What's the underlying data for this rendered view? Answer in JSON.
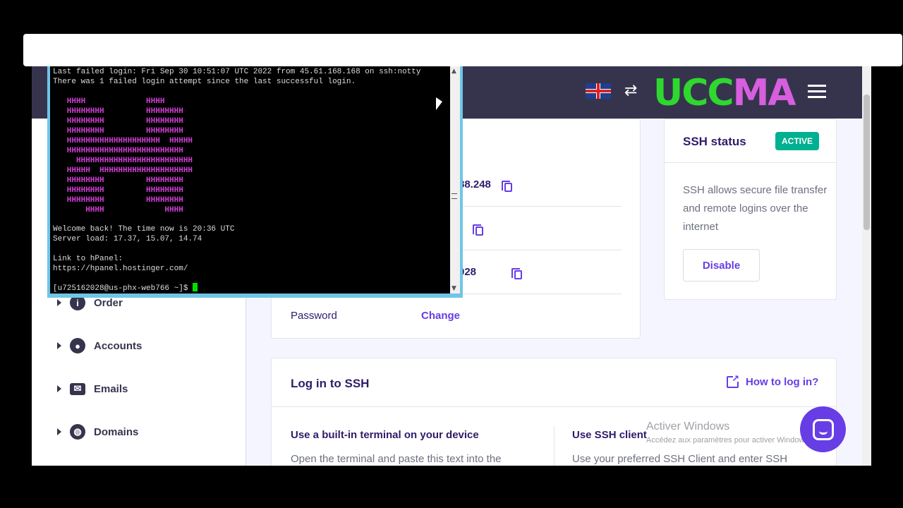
{
  "topbar": {
    "flag_icon": "uk-flag-icon",
    "switch_icon": "arrows-icon",
    "menu_icon": "hamburger-icon"
  },
  "logo": {
    "text_green": "UCC",
    "text_pink": "MA"
  },
  "sidebar": {
    "items": [
      {
        "label": "Order",
        "icon": "info-icon"
      },
      {
        "label": "Accounts",
        "icon": "user-icon"
      },
      {
        "label": "Emails",
        "icon": "mail-icon"
      },
      {
        "label": "Domains",
        "icon": "globe-icon"
      }
    ]
  },
  "ssh_details": {
    "ip_partial": "88.248",
    "port_partial": "",
    "user_partial": "028",
    "password_label": "Password",
    "password_action": "Change"
  },
  "ssh_status": {
    "title": "SSH status",
    "badge": "ACTIVE",
    "description": "SSH allows secure file transfer and remote logins over the internet",
    "button": "Disable"
  },
  "login_ssh": {
    "title": "Log in to SSH",
    "help_link": "How to log in?",
    "col1_title": "Use a built-in terminal on your device",
    "col1_text": "Open the terminal and paste this text into the",
    "col2_title": "Use SSH client",
    "col2_text": "Use your preferred SSH Client and enter SSH"
  },
  "terminal": {
    "line1": "Last failed login: Fri Sep 30 10:51:07 UTC 2022 from 45.61.168.168 on ssh:notty",
    "line2": "There was 1 failed login attempt since the last successful login.",
    "art": [
      "   HHHH             HHHH",
      "   HHHHHHHH         HHHHHHHH",
      "   HHHHHHHH         HHHHHHHH",
      "   HHHHHHHH         HHHHHHHH",
      "   HHHHHHHHHHHHHHHHHHHH  HHHHH",
      "   HHHHHHHHHHHHHHHHHHHHHHHHH",
      "     HHHHHHHHHHHHHHHHHHHHHHHHH",
      "   HHHHH  HHHHHHHHHHHHHHHHHHHH",
      "   HHHHHHHH         HHHHHHHH",
      "   HHHHHHHH         HHHHHHHH",
      "   HHHHHHHH         HHHHHHHH",
      "       HHHH             HHHH"
    ],
    "welcome": "Welcome back! The time now is 20:36 UTC",
    "load": "Server load: 17.37, 15.07, 14.74",
    "link_label": "Link to hPanel:",
    "link_url": "https://hpanel.hostinger.com/",
    "prompt": "[u725162028@us-phx-web766 ~]$ "
  },
  "watermark": {
    "title": "Activer Windows",
    "subtitle": "Accédez aux paramètres pour activer Windows."
  },
  "colors": {
    "accent": "#673de6",
    "active": "#00b090",
    "topbar": "#36344d"
  }
}
